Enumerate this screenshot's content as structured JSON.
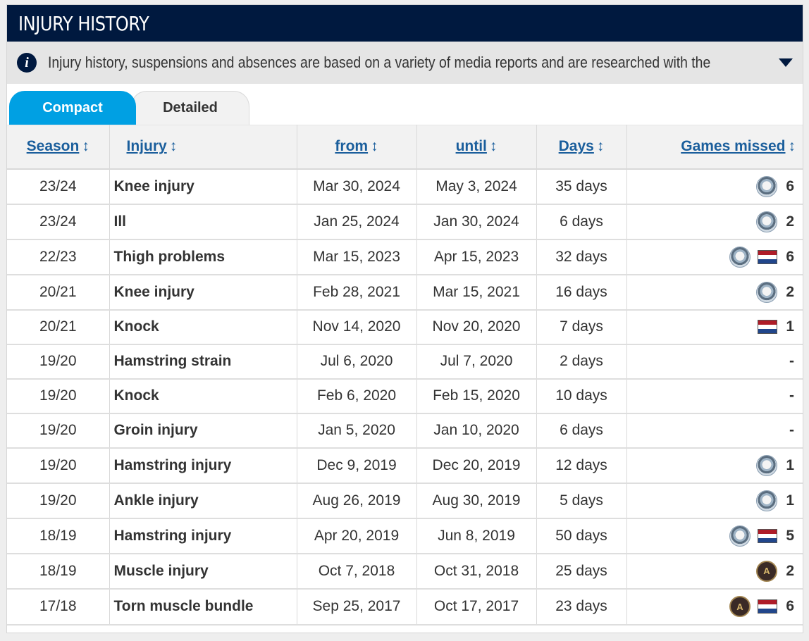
{
  "header": {
    "title": "INJURY HISTORY"
  },
  "info": {
    "text": "Injury history, suspensions and absences are based on a variety of media reports and are researched with the great…"
  },
  "tabs": [
    {
      "label": "Compact",
      "active": true
    },
    {
      "label": "Detailed",
      "active": false
    }
  ],
  "columns": {
    "season": "Season",
    "injury": "Injury",
    "from": "from",
    "until": "until",
    "days": "Days",
    "games": "Games missed"
  },
  "sort_glyph": "↕",
  "rows": [
    {
      "season": "23/24",
      "injury": "Knee injury",
      "from": "Mar 30, 2024",
      "until": "May 3, 2024",
      "days": "35 days",
      "games": "6",
      "clubs": [
        "newcastle-crest"
      ]
    },
    {
      "season": "23/24",
      "injury": "Ill",
      "from": "Jan 25, 2024",
      "until": "Jan 30, 2024",
      "days": "6 days",
      "games": "2",
      "clubs": [
        "newcastle-crest"
      ]
    },
    {
      "season": "22/23",
      "injury": "Thigh problems",
      "from": "Mar 15, 2023",
      "until": "Apr 15, 2023",
      "days": "32 days",
      "games": "6",
      "clubs": [
        "newcastle-crest",
        "netherlands-flag"
      ]
    },
    {
      "season": "20/21",
      "injury": "Knee injury",
      "from": "Feb 28, 2021",
      "until": "Mar 15, 2021",
      "days": "16 days",
      "games": "2",
      "clubs": [
        "newcastle-crest"
      ]
    },
    {
      "season": "20/21",
      "injury": "Knock",
      "from": "Nov 14, 2020",
      "until": "Nov 20, 2020",
      "days": "7 days",
      "games": "1",
      "clubs": [
        "netherlands-flag"
      ]
    },
    {
      "season": "19/20",
      "injury": "Hamstring strain",
      "from": "Jul 6, 2020",
      "until": "Jul 7, 2020",
      "days": "2 days",
      "games": "-",
      "clubs": []
    },
    {
      "season": "19/20",
      "injury": "Knock",
      "from": "Feb 6, 2020",
      "until": "Feb 15, 2020",
      "days": "10 days",
      "games": "-",
      "clubs": []
    },
    {
      "season": "19/20",
      "injury": "Groin injury",
      "from": "Jan 5, 2020",
      "until": "Jan 10, 2020",
      "days": "6 days",
      "games": "-",
      "clubs": []
    },
    {
      "season": "19/20",
      "injury": "Hamstring injury",
      "from": "Dec 9, 2019",
      "until": "Dec 20, 2019",
      "days": "12 days",
      "games": "1",
      "clubs": [
        "newcastle-crest"
      ]
    },
    {
      "season": "19/20",
      "injury": "Ankle injury",
      "from": "Aug 26, 2019",
      "until": "Aug 30, 2019",
      "days": "5 days",
      "games": "1",
      "clubs": [
        "newcastle-crest"
      ]
    },
    {
      "season": "18/19",
      "injury": "Hamstring injury",
      "from": "Apr 20, 2019",
      "until": "Jun 8, 2019",
      "days": "50 days",
      "games": "5",
      "clubs": [
        "newcastle-crest",
        "netherlands-flag"
      ]
    },
    {
      "season": "18/19",
      "injury": "Muscle injury",
      "from": "Oct 7, 2018",
      "until": "Oct 31, 2018",
      "days": "25 days",
      "games": "2",
      "clubs": [
        "atlanta-crest"
      ]
    },
    {
      "season": "17/18",
      "injury": "Torn muscle bundle",
      "from": "Sep 25, 2017",
      "until": "Oct 17, 2017",
      "days": "23 days",
      "games": "6",
      "clubs": [
        "atlanta-crest",
        "netherlands-flag"
      ]
    }
  ],
  "colors": {
    "header_bg": "#00193f",
    "tab_active": "#00a0e3",
    "link": "#1a5e9c",
    "flag_red": "#ae1c28",
    "flag_blue": "#21468b"
  }
}
